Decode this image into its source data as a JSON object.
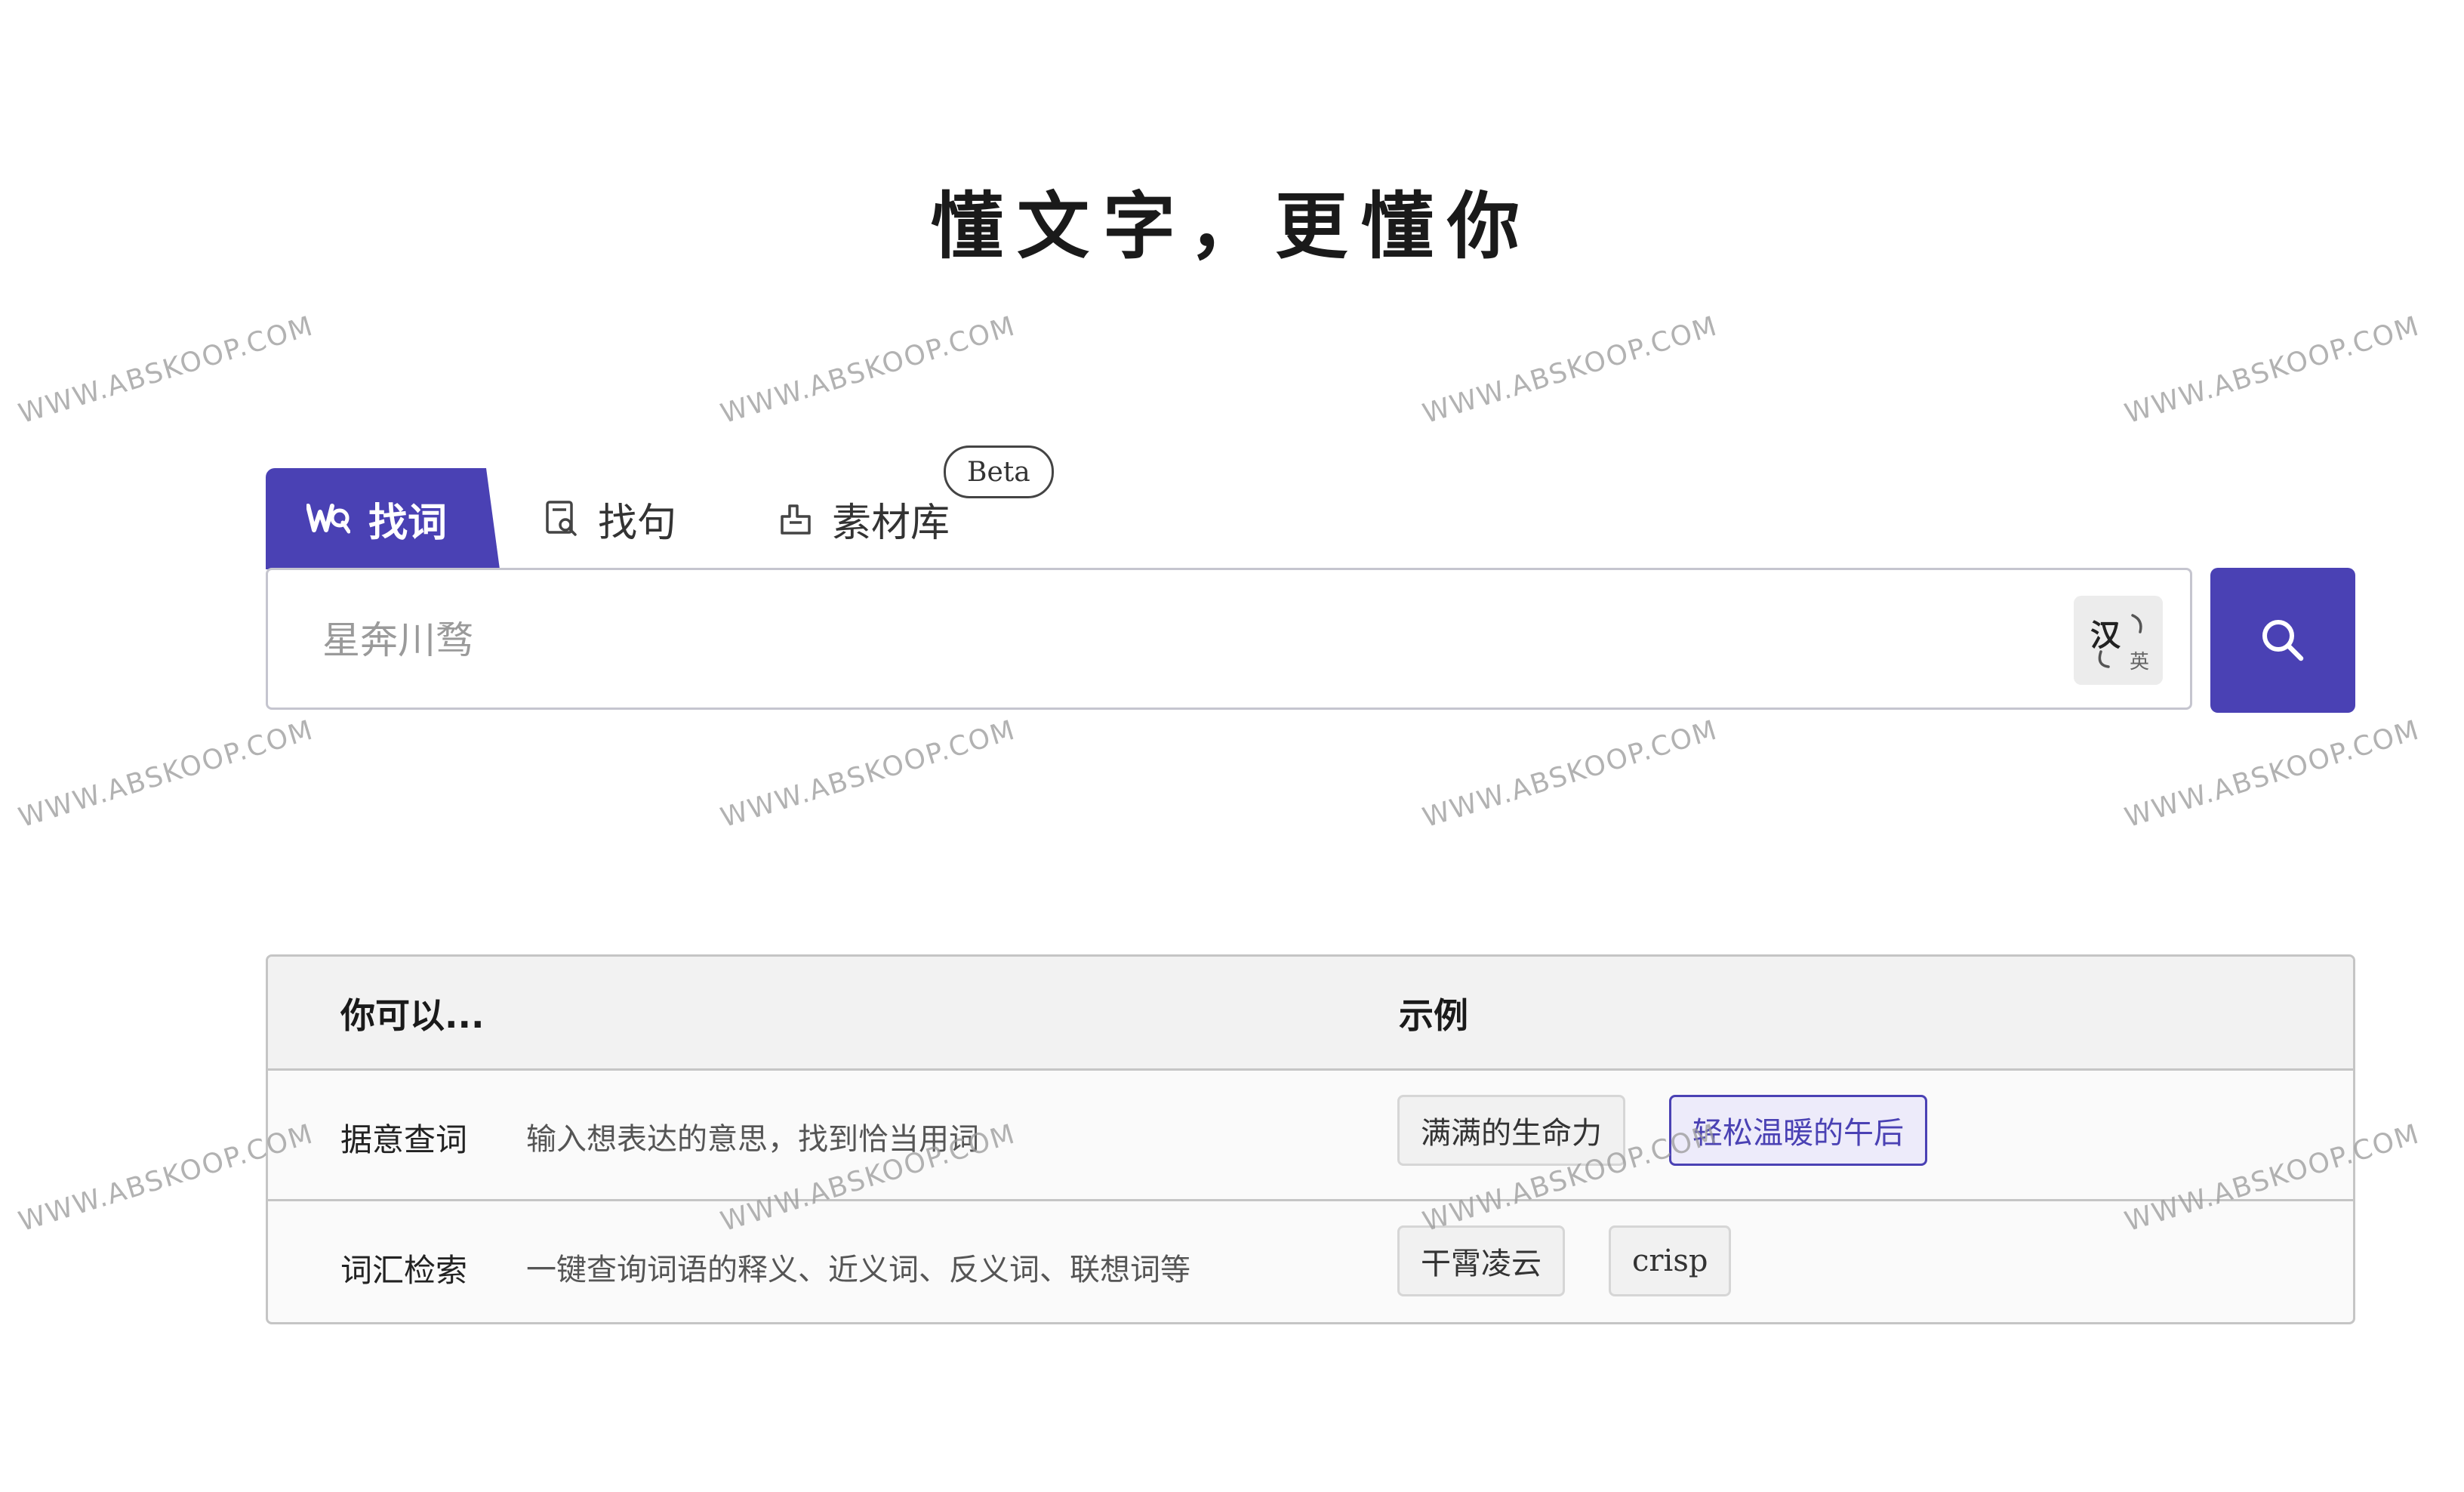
{
  "headline": "懂文字，更懂你",
  "tabs": [
    {
      "label": "找词",
      "icon": "wq-logo-icon",
      "active": true
    },
    {
      "label": "找句",
      "icon": "sentence-search-icon",
      "active": false
    },
    {
      "label": "素材库",
      "icon": "material-library-icon",
      "active": false
    }
  ],
  "beta_badge": "Beta",
  "search": {
    "placeholder": "星奔川骛",
    "value": "",
    "lang_toggle": {
      "primary": "汉",
      "secondary": "英"
    },
    "button_icon": "search-icon"
  },
  "table": {
    "headers": {
      "can": "你可以...",
      "example": "示例"
    },
    "rows": [
      {
        "feature": "据意查词",
        "description": "输入想表达的意思，找到恰当用词",
        "examples": [
          "满满的生命力",
          "轻松温暖的午后"
        ],
        "selected_example": 1
      },
      {
        "feature": "词汇检索",
        "description": "一键查询词语的释义、近义词、反义词、联想词等",
        "examples": [
          "干霄凌云",
          "crisp"
        ]
      }
    ]
  },
  "watermark": "WWW.ABSKOOP.COM",
  "colors": {
    "accent": "#4a41b4",
    "selected_bg": "#edebfa"
  }
}
